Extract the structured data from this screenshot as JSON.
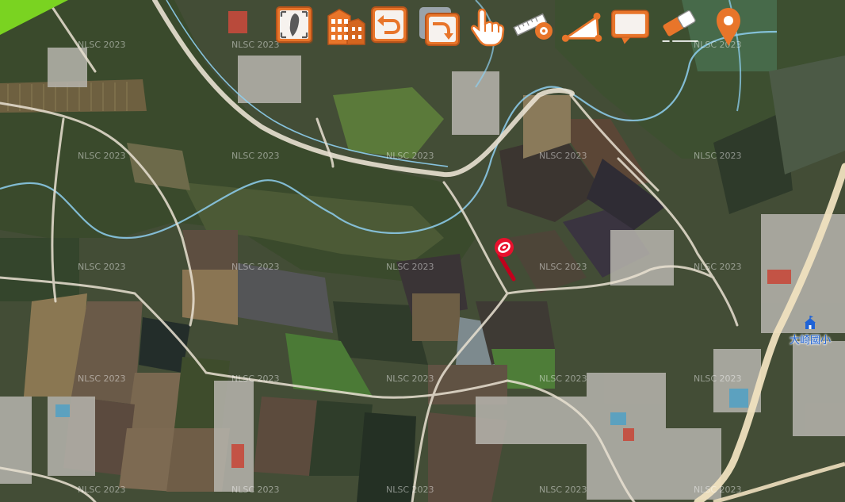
{
  "map": {
    "watermark_text": "NLSC 2023",
    "poi": {
      "school_label": "大崎國小",
      "icon": "school-flag-icon"
    },
    "marker": {
      "icon": "map-pin-marker-icon",
      "color": "#e8112d"
    },
    "colors": {
      "road": "#e9e1d2",
      "waterway": "#8ecff0",
      "highway": "#efe0bf",
      "toolbar_accent": "#e8752a",
      "corner": "#7ad321"
    }
  },
  "toolbar": {
    "tools": [
      {
        "name": "full-extent",
        "icon": "taiwan-full-extent-icon"
      },
      {
        "name": "3d-buildings",
        "icon": "building-icon"
      },
      {
        "name": "undo",
        "icon": "undo-arrow-icon"
      },
      {
        "name": "redo",
        "icon": "redo-arrow-icon"
      },
      {
        "name": "pan",
        "icon": "hand-pointer-icon"
      },
      {
        "name": "measure-distance",
        "icon": "ruler-icon"
      },
      {
        "name": "measure-area",
        "icon": "polygon-measure-icon"
      },
      {
        "name": "annotation",
        "icon": "speech-box-icon"
      },
      {
        "name": "eraser",
        "icon": "eraser-icon"
      },
      {
        "name": "location",
        "icon": "location-pin-icon"
      }
    ]
  }
}
